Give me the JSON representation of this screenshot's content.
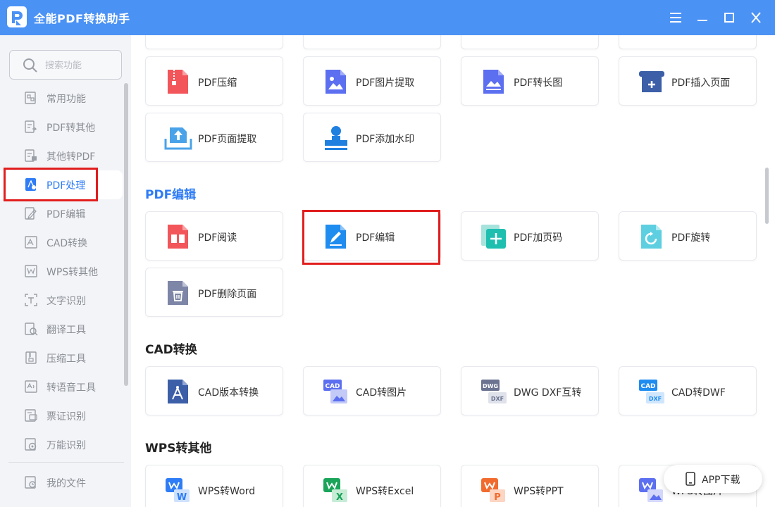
{
  "app": {
    "title": "全能PDF转换助手",
    "accent_color": "#4b92f5",
    "logo_icon": "pdf-logo-icon"
  },
  "window_controls": [
    "menu-icon",
    "minimize-icon",
    "maximize-icon",
    "close-icon"
  ],
  "search": {
    "placeholder": "搜索功能"
  },
  "sidebar": {
    "items": [
      {
        "label": "常用功能",
        "icon": "common-functions-icon"
      },
      {
        "label": "PDF转其他",
        "icon": "pdf-to-other-icon"
      },
      {
        "label": "其他转PDF",
        "icon": "other-to-pdf-icon"
      },
      {
        "label": "PDF处理",
        "icon": "pdf-process-icon",
        "active": true
      },
      {
        "label": "PDF编辑",
        "icon": "pdf-edit-icon"
      },
      {
        "label": "CAD转换",
        "icon": "cad-convert-icon"
      },
      {
        "label": "WPS转其他",
        "icon": "wps-to-other-icon"
      },
      {
        "label": "文字识别",
        "icon": "text-recognition-icon"
      },
      {
        "label": "翻译工具",
        "icon": "translate-tool-icon"
      },
      {
        "label": "压缩工具",
        "icon": "compress-tool-icon"
      },
      {
        "label": "转语音工具",
        "icon": "to-speech-icon"
      },
      {
        "label": "票证识别",
        "icon": "ticket-recognition-icon"
      },
      {
        "label": "万能识别",
        "icon": "universal-recognition-icon"
      }
    ],
    "my_files": {
      "label": "我的文件",
      "icon": "my-files-icon"
    }
  },
  "pdf_process_cards": [
    {
      "label": "PDF压缩",
      "icon": "pdf-compress-icon"
    },
    {
      "label": "PDF图片提取",
      "icon": "pdf-image-extract-icon"
    },
    {
      "label": "PDF转长图",
      "icon": "pdf-long-image-icon"
    },
    {
      "label": "PDF插入页面",
      "icon": "pdf-insert-page-icon"
    },
    {
      "label": "PDF页面提取",
      "icon": "pdf-page-extract-icon"
    },
    {
      "label": "PDF添加水印",
      "icon": "pdf-watermark-icon"
    }
  ],
  "sections": {
    "pdf_edit": {
      "title": "PDF编辑",
      "cards": [
        {
          "label": "PDF阅读",
          "icon": "pdf-read-icon"
        },
        {
          "label": "PDF编辑",
          "icon": "pdf-edit-card-icon",
          "highlighted": true
        },
        {
          "label": "PDF加页码",
          "icon": "pdf-page-number-icon"
        },
        {
          "label": "PDF旋转",
          "icon": "pdf-rotate-icon"
        },
        {
          "label": "PDF删除页面",
          "icon": "pdf-delete-page-icon"
        }
      ]
    },
    "cad_convert": {
      "title": "CAD转换",
      "cards": [
        {
          "label": "CAD版本转换",
          "icon": "cad-version-icon"
        },
        {
          "label": "CAD转图片",
          "icon": "cad-to-image-icon",
          "badge": "CAD"
        },
        {
          "label": "DWG DXF互转",
          "icon": "dwg-dxf-icon",
          "badge": "DWG",
          "badge2": "DXF"
        },
        {
          "label": "CAD转DWF",
          "icon": "cad-to-dwf-icon",
          "badge": "CAD",
          "badge2": "DXF"
        }
      ]
    },
    "wps_convert": {
      "title": "WPS转其他",
      "cards": [
        {
          "label": "WPS转Word",
          "icon": "wps-to-word-icon"
        },
        {
          "label": "WPS转Excel",
          "icon": "wps-to-excel-icon"
        },
        {
          "label": "WPS转PPT",
          "icon": "wps-to-ppt-icon"
        },
        {
          "label": "WPS转图片",
          "icon": "wps-to-image-icon"
        }
      ]
    }
  },
  "app_download": {
    "label": "APP下载",
    "icon": "phone-icon"
  }
}
